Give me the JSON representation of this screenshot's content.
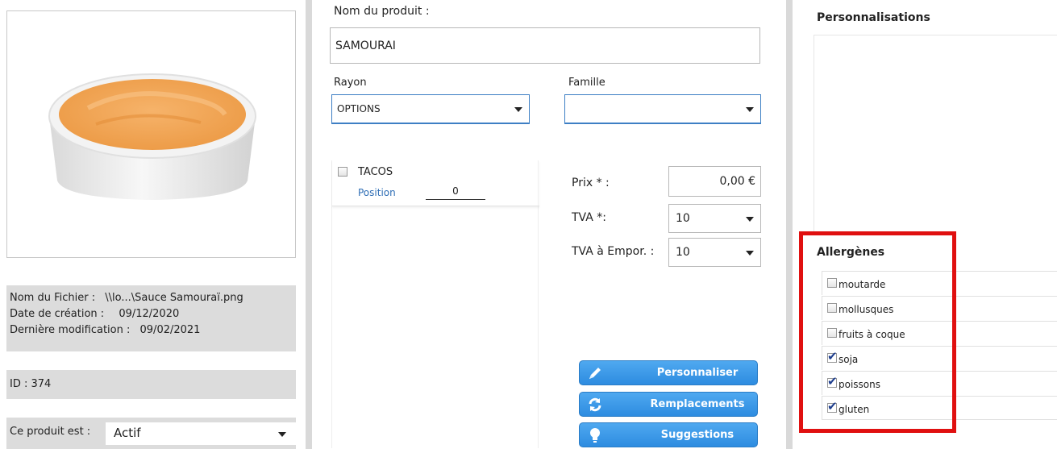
{
  "product_image": {
    "alt_icon": "sauce-bowl-icon",
    "bowl_color": "#f0a050"
  },
  "file_info": {
    "filename_label": "Nom du Fichier :",
    "filename_value": "\\\\lo...\\Sauce Samouraï.png",
    "created_label": "Date de création :",
    "created_value": "09/12/2020",
    "modified_label": "Dernière modification :",
    "modified_value": "09/02/2021"
  },
  "id_line": "ID : 374",
  "status": {
    "label": "Ce produit est :",
    "value": "Actif"
  },
  "product_name": {
    "label": "Nom du produit :",
    "value": "SAMOURAI"
  },
  "rayon": {
    "label": "Rayon",
    "value": "OPTIONS"
  },
  "famille": {
    "label": "Famille",
    "value": ""
  },
  "rayon_item": {
    "name": "TACOS",
    "position_label": "Position",
    "position_value": "0"
  },
  "prix": {
    "label": "Prix * :",
    "value": "0,00 €"
  },
  "tva": {
    "label": "TVA *:",
    "value": "10"
  },
  "tva_emporter": {
    "label": "TVA à Empor. :",
    "value": "10"
  },
  "buttons": {
    "personnaliser": "Personnaliser",
    "remplacements": "Remplacements",
    "suggestions": "Suggestions"
  },
  "personnalisations_title": "Personnalisations",
  "allergenes": {
    "title": "Allergènes",
    "items": [
      {
        "label": "moutarde",
        "checked": false
      },
      {
        "label": "mollusques",
        "checked": false
      },
      {
        "label": "fruits à coque",
        "checked": false
      },
      {
        "label": "soja",
        "checked": true
      },
      {
        "label": "poissons",
        "checked": true
      },
      {
        "label": "gluten",
        "checked": true
      }
    ]
  },
  "colors": {
    "accent": "#2d8ce0",
    "highlight": "#e01010",
    "panel_gray": "#dcdcdc"
  }
}
